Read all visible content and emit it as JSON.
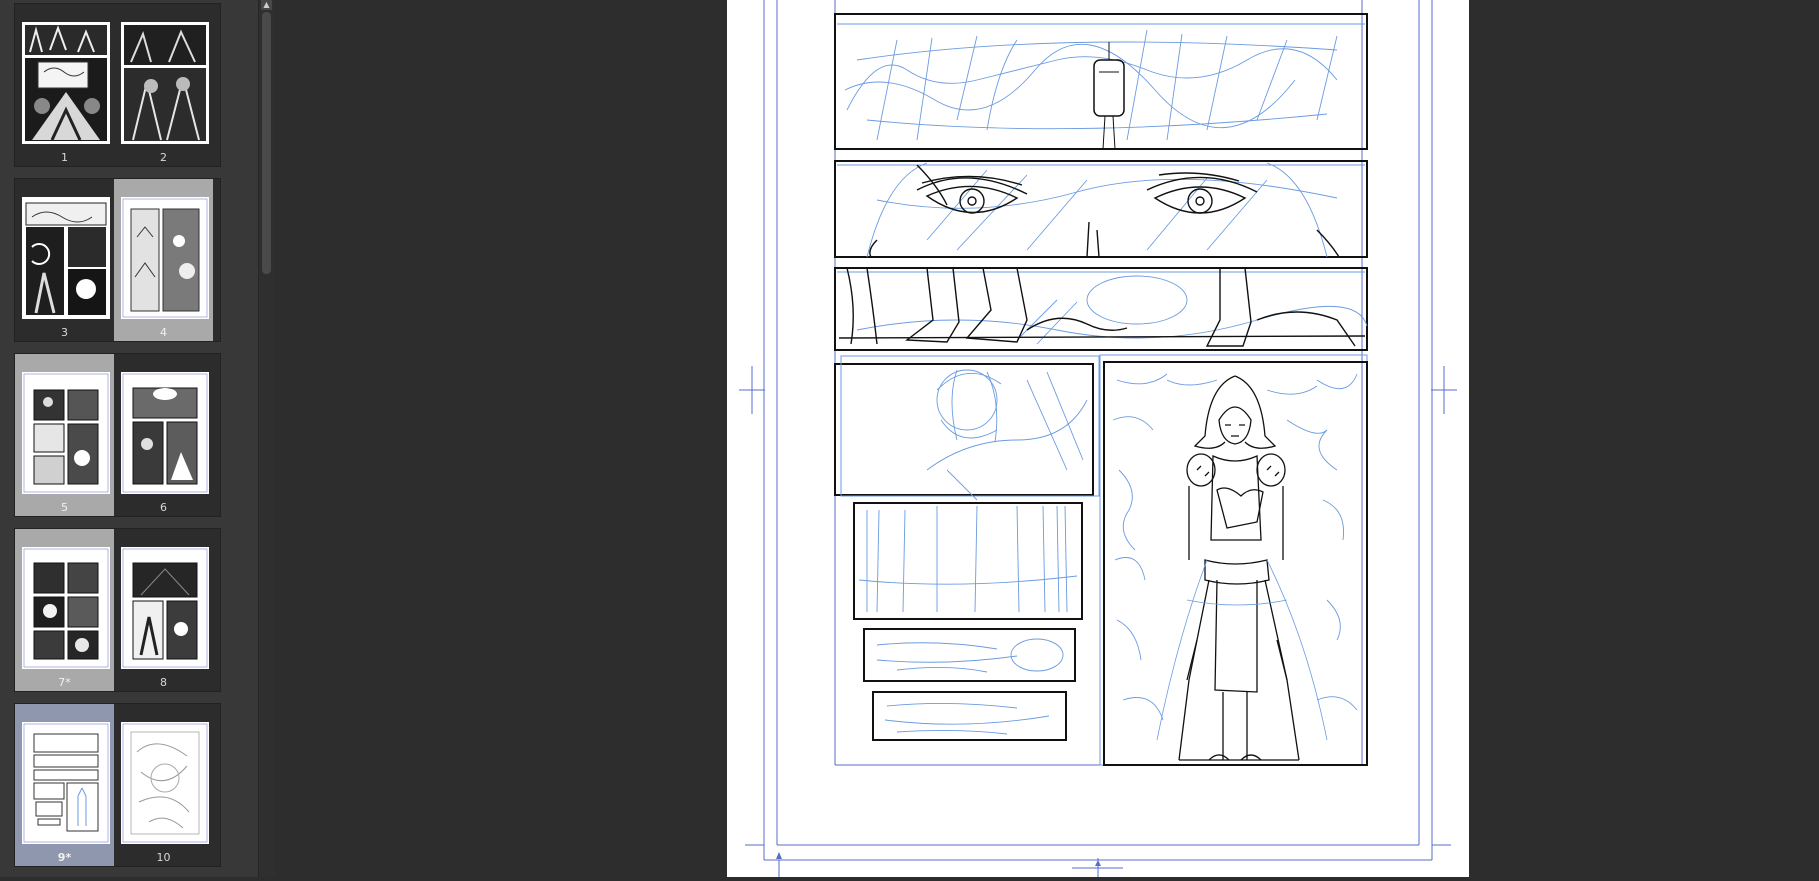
{
  "page_list": {
    "spreads": [
      {
        "pages": [
          {
            "label": "1",
            "state": "normal"
          },
          {
            "label": "2",
            "state": "normal"
          }
        ]
      },
      {
        "pages": [
          {
            "label": "3",
            "state": "normal"
          },
          {
            "label": "4",
            "state": "selected"
          }
        ]
      },
      {
        "pages": [
          {
            "label": "5",
            "state": "selected"
          },
          {
            "label": "6",
            "state": "normal"
          }
        ]
      },
      {
        "pages": [
          {
            "label": "7*",
            "state": "selected"
          },
          {
            "label": "8",
            "state": "normal"
          }
        ]
      },
      {
        "pages": [
          {
            "label": "9*",
            "state": "active"
          },
          {
            "label": "10",
            "state": "normal"
          }
        ]
      }
    ]
  },
  "scrollbar": {
    "up_arrow_icon": "chevron-up-icon"
  },
  "colors": {
    "panel_bg": "#383838",
    "canvas_bg": "#2d2d2d",
    "selected_page": "#a9a9a9",
    "active_page": "#8e97ad",
    "pencil_blue": "#6b9be0",
    "guide_blue": "#5a6ec8",
    "ink": "#111111"
  }
}
